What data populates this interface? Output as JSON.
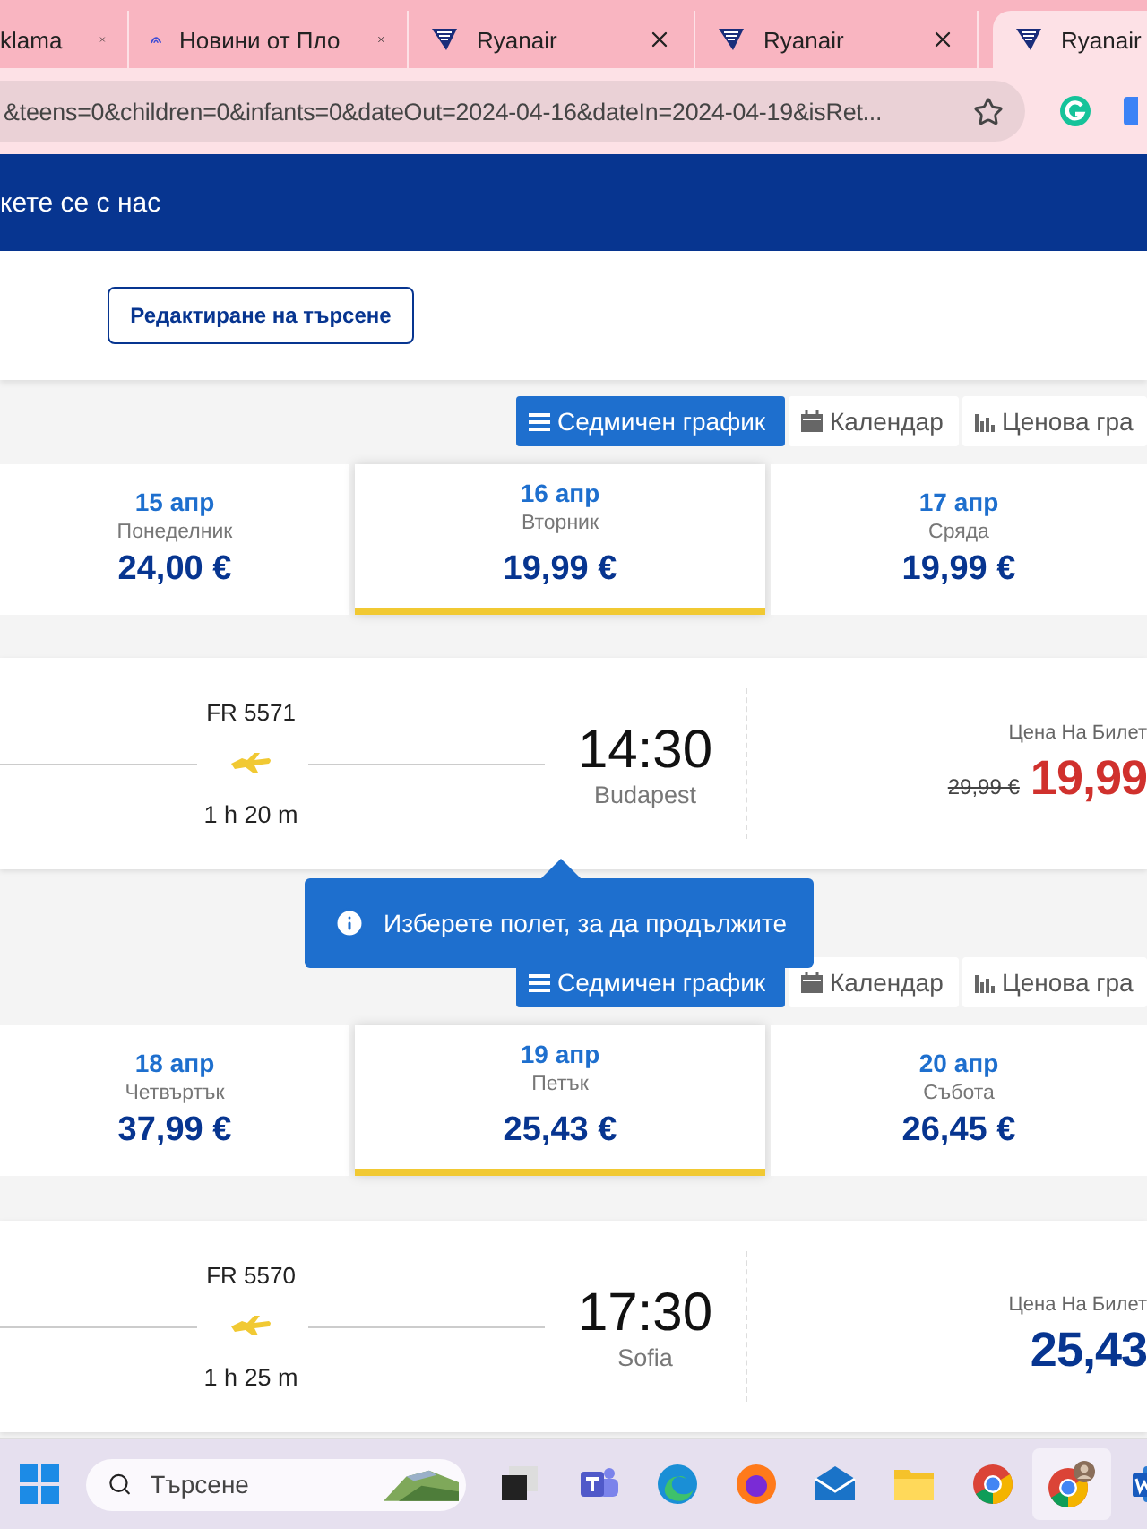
{
  "browser": {
    "tabs": [
      {
        "title": "klama",
        "kind": "plain",
        "selected": false
      },
      {
        "title": "Новини от Пло",
        "kind": "news",
        "selected": false
      },
      {
        "title": "Ryanair",
        "kind": "airline",
        "selected": false
      },
      {
        "title": "Ryanair",
        "kind": "airline",
        "selected": false
      },
      {
        "title": "Ryanair",
        "kind": "airline",
        "selected": true
      }
    ],
    "url": "&teens=0&children=0&infants=0&dateOut=2024-04-16&dateIn=2024-04-19&isRet..."
  },
  "header": {
    "link": "кете се с нас"
  },
  "edit_search_button": "Редактиране на търсене",
  "journeys": [
    {
      "views": [
        {
          "label": "Седмичен график",
          "selected": true
        },
        {
          "label": "Календар",
          "selected": false
        },
        {
          "label": "Ценова гра",
          "selected": false
        }
      ],
      "dates": [
        {
          "date": "15 апр",
          "weekday": "Понеделник",
          "price": "24,00 €",
          "selected": false
        },
        {
          "date": "16 апр",
          "weekday": "Вторник",
          "price": "19,99 €",
          "selected": true
        },
        {
          "date": "17 апр",
          "weekday": "Сряда",
          "price": "19,99 €",
          "selected": false
        }
      ],
      "flight": {
        "number": "FR 5571",
        "duration": "1 h 20 m",
        "time": "14:30",
        "city": "Budapest",
        "price_label": "Цена На Билет",
        "old_price": "29,99 €",
        "price": "19,99",
        "sale": true
      }
    },
    {
      "views": [
        {
          "label": "Седмичен график",
          "selected": true
        },
        {
          "label": "Календар",
          "selected": false
        },
        {
          "label": "Ценова гра",
          "selected": false
        }
      ],
      "dates": [
        {
          "date": "18 апр",
          "weekday": "Четвъртък",
          "price": "37,99 €",
          "selected": false
        },
        {
          "date": "19 апр",
          "weekday": "Петък",
          "price": "25,43 €",
          "selected": true
        },
        {
          "date": "20 апр",
          "weekday": "Събота",
          "price": "26,45 €",
          "selected": false
        }
      ],
      "flight": {
        "number": "FR 5570",
        "duration": "1 h 25 m",
        "time": "17:30",
        "city": "Sofia",
        "price_label": "Цена На Билет",
        "price": "25,43",
        "sale": false
      }
    }
  ],
  "tooltip": {
    "text": "Изберете полет, за да продължите"
  },
  "taskbar": {
    "search_placeholder": "Търсене"
  }
}
